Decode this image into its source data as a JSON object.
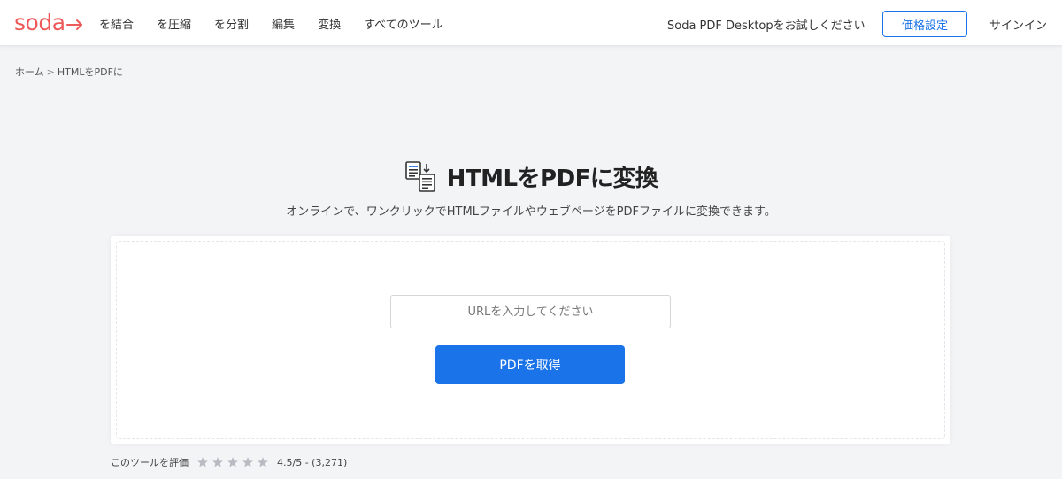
{
  "header": {
    "logo_text": "soda",
    "nav": [
      "を結合",
      "を圧縮",
      "を分割",
      "編集",
      "変換",
      "すべてのツール"
    ],
    "try_desktop": "Soda PDF Desktopをお試しください",
    "pricing_label": "価格設定",
    "signin_label": "サインイン"
  },
  "breadcrumb": {
    "home": "ホーム",
    "separator": ">",
    "current": "HTMLをPDFに"
  },
  "main": {
    "title": "HTMLをPDFに変換",
    "title_icon": "html-to-pdf-icon",
    "subtitle": "オンラインで、ワンクリックでHTMLファイルやウェブページをPDFファイルに変換できます。"
  },
  "form": {
    "url_value": "",
    "url_placeholder": "URLを入力してください",
    "submit_label": "PDFを取得"
  },
  "rating": {
    "label": "このツールを評価",
    "stars_filled": 5,
    "stars_total": 5,
    "score_text": "4.5/5 - (3,271)"
  },
  "colors": {
    "brand": "#ee5a5a",
    "accent": "#1a73e8",
    "star": "#b8bcc2"
  }
}
